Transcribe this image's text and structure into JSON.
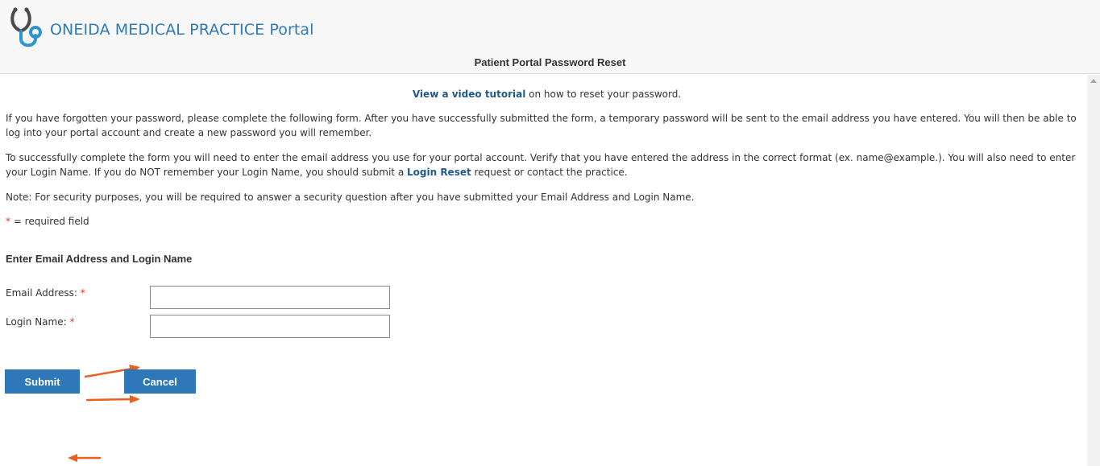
{
  "header": {
    "portal_title": "ONEIDA MEDICAL PRACTICE Portal",
    "page_subtitle": "Patient Portal Password Reset",
    "logo_icon": "stethoscope-icon"
  },
  "intro": {
    "tutorial_link": "View a video tutorial",
    "tutorial_suffix": " on how to reset your password.",
    "paragraph_1": "If you have forgotten your password, please complete the following form. After you have successfully submitted the form, a temporary password will be sent to the email address you have entered. You will then be able to log into your portal account and create a new password you will remember.",
    "paragraph_2_before_link": "To successfully complete the form you will need to enter the email address you use for your portal account. Verify that you have entered the address in the correct format (ex. name@example.). You will also need to enter your Login Name. If you do NOT remember your Login Name, you should submit a ",
    "paragraph_2_link": "Login Reset",
    "paragraph_2_after_link": " request or contact the practice.",
    "note": "Note: For security purposes, you will be required to answer a security question after you have submitted your Email Address and Login Name.",
    "required_asterisk": "*",
    "required_text": " = required field"
  },
  "form": {
    "section_heading": "Enter Email Address and Login Name",
    "email_label": "Email Address:",
    "email_value": "",
    "login_label": "Login Name:",
    "login_value": "",
    "required_marker": "*",
    "submit_label": "Submit",
    "cancel_label": "Cancel"
  },
  "colors": {
    "brand_blue": "#2f7ab8",
    "link_blue": "#1f5a88",
    "button_blue": "#2e77b8",
    "required_red": "#e03a1a",
    "annotation_orange": "#e8601c"
  }
}
